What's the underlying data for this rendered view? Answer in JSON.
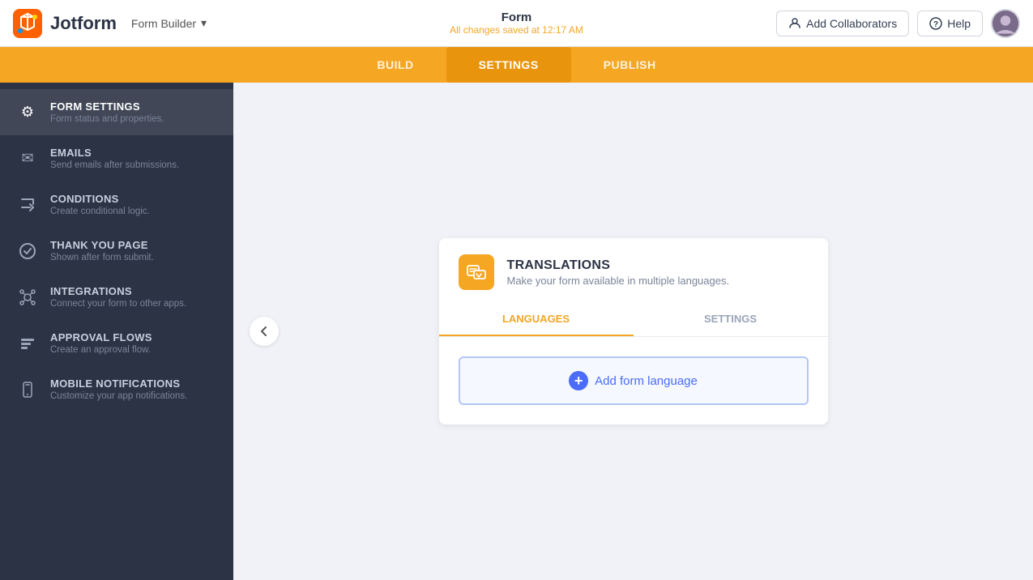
{
  "header": {
    "logo_text": "Jotform",
    "form_builder_label": "Form Builder",
    "form_title": "Form",
    "saved_status": "All changes saved at 12:17 AM",
    "add_collaborators_label": "Add Collaborators",
    "help_label": "Help",
    "chevron_down": "▾"
  },
  "nav_tabs": [
    {
      "id": "build",
      "label": "BUILD",
      "active": false
    },
    {
      "id": "settings",
      "label": "SETTINGS",
      "active": true
    },
    {
      "id": "publish",
      "label": "PUBLISH",
      "active": false
    }
  ],
  "sidebar": {
    "items": [
      {
        "id": "form-settings",
        "title": "FORM SETTINGS",
        "subtitle": "Form status and properties.",
        "active": true,
        "icon": "⚙"
      },
      {
        "id": "emails",
        "title": "EMAILS",
        "subtitle": "Send emails after submissions.",
        "active": false,
        "icon": "✉"
      },
      {
        "id": "conditions",
        "title": "CONDITIONS",
        "subtitle": "Create conditional logic.",
        "active": false,
        "icon": "✂"
      },
      {
        "id": "thank-you",
        "title": "THANK YOU PAGE",
        "subtitle": "Shown after form submit.",
        "active": false,
        "icon": "✓"
      },
      {
        "id": "integrations",
        "title": "INTEGRATIONS",
        "subtitle": "Connect your form to other apps.",
        "active": false,
        "icon": "✱"
      },
      {
        "id": "approval-flows",
        "title": "APPROVAL FLOWS",
        "subtitle": "Create an approval flow.",
        "active": false,
        "icon": "☰"
      },
      {
        "id": "mobile-notifications",
        "title": "MOBILE NOTIFICATIONS",
        "subtitle": "Customize your app notifications.",
        "active": false,
        "icon": "📱"
      }
    ]
  },
  "translations_panel": {
    "icon": "🌐",
    "title": "TRANSLATIONS",
    "subtitle": "Make your form available in multiple languages.",
    "tabs": [
      {
        "id": "languages",
        "label": "LANGUAGES",
        "active": true
      },
      {
        "id": "settings",
        "label": "SETTINGS",
        "active": false
      }
    ],
    "add_language_label": "Add form language",
    "plus_symbol": "+"
  }
}
